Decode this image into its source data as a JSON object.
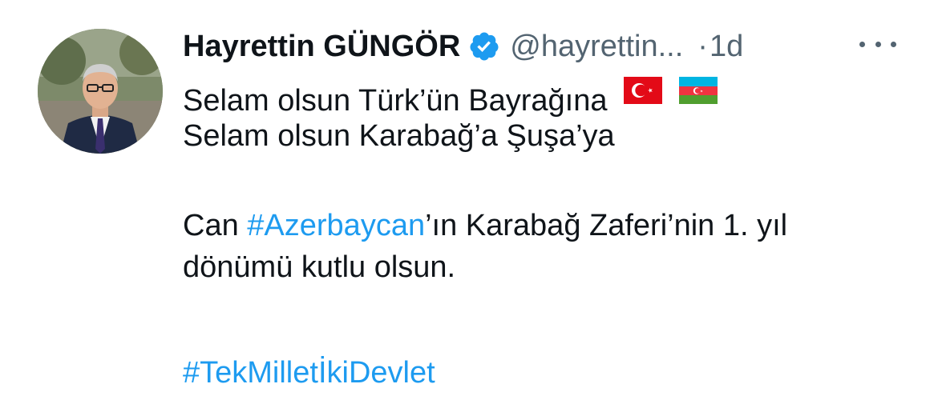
{
  "tweet": {
    "author_name": "Hayrettin GÜNGÖR",
    "handle": "@hayrettin...",
    "separator": "·",
    "time": "1d",
    "line1_text": "Selam olsun Türk’ün Bayrağına",
    "line1_flags": [
      "turkey-flag",
      "azerbaijan-flag"
    ],
    "line2": "Selam olsun Karabağ’a Şuşa’ya",
    "line3_prefix": "Can ",
    "line3_hashtag": "#Azerbaycan",
    "line3_suffix": "’ın Karabağ Zaferi’nin 1. yıl",
    "line4": "dönümü kutlu olsun.",
    "hashtag2": "#TekMilletİkiDevlet"
  },
  "colors": {
    "text": "#0f1419",
    "muted": "#536471",
    "link": "#1d9bf0",
    "verified": "#1d9bf0"
  },
  "icons": {
    "verified": "verified-badge-icon",
    "more": "more-options-icon"
  }
}
